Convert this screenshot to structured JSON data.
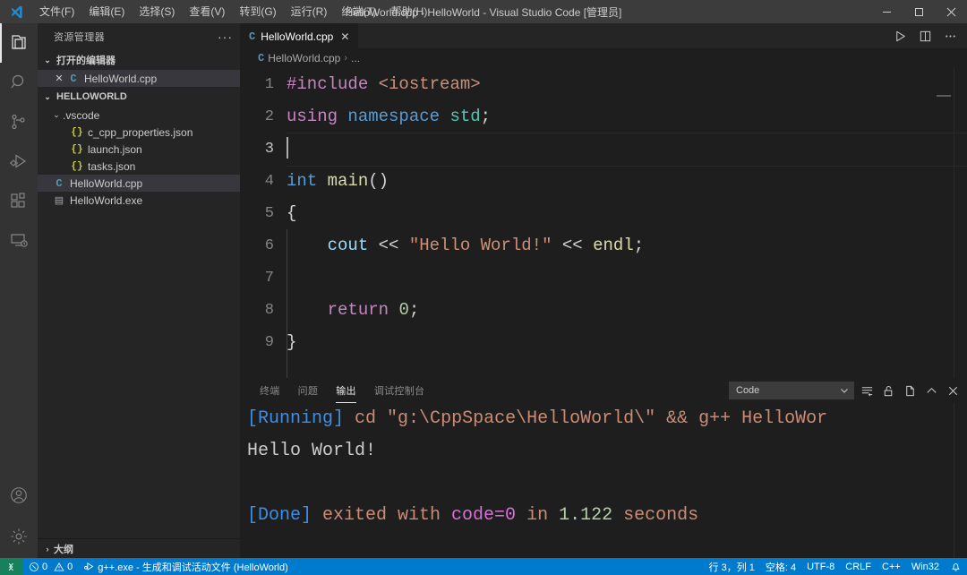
{
  "window": {
    "title": "HelloWorld.cpp - HelloWorld - Visual Studio Code [管理员]",
    "logo_icon": "vscode-logo-icon",
    "minimize_icon": "minimize-icon",
    "maximize_icon": "maximize-icon",
    "close_icon": "close-icon"
  },
  "menu": {
    "items": [
      {
        "label": "文件(F)"
      },
      {
        "label": "编辑(E)"
      },
      {
        "label": "选择(S)"
      },
      {
        "label": "查看(V)"
      },
      {
        "label": "转到(G)"
      },
      {
        "label": "运行(R)"
      },
      {
        "label": "终端(T)"
      },
      {
        "label": "帮助(H)"
      }
    ]
  },
  "activity_bar": {
    "items": [
      {
        "name": "explorer",
        "icon": "files-icon",
        "active": true
      },
      {
        "name": "search",
        "icon": "search-icon",
        "active": false
      },
      {
        "name": "source-control",
        "icon": "source-control-icon",
        "active": false
      },
      {
        "name": "run-and-debug",
        "icon": "run-debug-icon",
        "active": false
      },
      {
        "name": "extensions",
        "icon": "extensions-icon",
        "active": false
      },
      {
        "name": "remote-explorer",
        "icon": "remote-explorer-icon",
        "active": false
      }
    ],
    "bottom": [
      {
        "name": "accounts",
        "icon": "account-icon"
      },
      {
        "name": "manage",
        "icon": "gear-icon"
      }
    ]
  },
  "sidebar": {
    "title": "资源管理器",
    "more_actions": "···",
    "open_editors": {
      "label": "打开的编辑器",
      "expanded": true,
      "items": [
        {
          "label": "HelloWorld.cpp",
          "icon": "cpp-file-icon",
          "close": "✕",
          "selected": true
        }
      ]
    },
    "project": {
      "label": "HELLOWORLD",
      "expanded": true,
      "items": [
        {
          "label": ".vscode",
          "icon": "folder-icon",
          "indent": 1,
          "expanded": true,
          "selected": false
        },
        {
          "label": "c_cpp_properties.json",
          "icon": "json-file-icon",
          "indent": 2,
          "selected": false
        },
        {
          "label": "launch.json",
          "icon": "json-file-icon",
          "indent": 2,
          "selected": false
        },
        {
          "label": "tasks.json",
          "icon": "json-file-icon",
          "indent": 2,
          "selected": false
        },
        {
          "label": "HelloWorld.cpp",
          "icon": "cpp-file-icon",
          "indent": 1,
          "selected": true
        },
        {
          "label": "HelloWorld.exe",
          "icon": "exe-file-icon",
          "indent": 1,
          "selected": false
        }
      ]
    },
    "outline": {
      "label": "大纲",
      "expanded": false
    }
  },
  "editor": {
    "tab": {
      "label": "HelloWorld.cpp",
      "icon": "cpp-file-icon",
      "close": "✕",
      "active": true
    },
    "actions": [
      {
        "name": "run-code",
        "icon": "play-icon",
        "highlighted": true
      },
      {
        "name": "split-editor",
        "icon": "split-editor-icon",
        "highlighted": false
      },
      {
        "name": "more-actions",
        "icon": "ellipsis-icon",
        "highlighted": false
      }
    ],
    "highlight_color": "#ffff00",
    "breadcrumb": {
      "file": "HelloWorld.cpp",
      "separator": "›",
      "trail": "..."
    },
    "lines": [
      {
        "num": "1",
        "active": false,
        "tokens": [
          {
            "t": "#include",
            "c": "s-dir"
          },
          {
            "t": " ",
            "c": "s-pn"
          },
          {
            "t": "<iostream>",
            "c": "s-inc"
          }
        ]
      },
      {
        "num": "2",
        "active": false,
        "tokens": [
          {
            "t": "using",
            "c": "s-kw"
          },
          {
            "t": " ",
            "c": "s-pn"
          },
          {
            "t": "namespace",
            "c": "s-type"
          },
          {
            "t": " ",
            "c": "s-pn"
          },
          {
            "t": "std",
            "c": "s-ns"
          },
          {
            "t": ";",
            "c": "s-pn"
          }
        ]
      },
      {
        "num": "3",
        "active": true,
        "tokens": []
      },
      {
        "num": "4",
        "active": false,
        "tokens": [
          {
            "t": "int",
            "c": "s-type"
          },
          {
            "t": " ",
            "c": "s-pn"
          },
          {
            "t": "main",
            "c": "s-fn"
          },
          {
            "t": "()",
            "c": "s-pn"
          }
        ]
      },
      {
        "num": "5",
        "active": false,
        "tokens": [
          {
            "t": "{",
            "c": "s-pn"
          }
        ]
      },
      {
        "num": "6",
        "active": false,
        "tokens": [
          {
            "t": "    ",
            "c": "s-pn"
          },
          {
            "t": "cout",
            "c": "s-var"
          },
          {
            "t": " ",
            "c": "s-pn"
          },
          {
            "t": "<<",
            "c": "s-op"
          },
          {
            "t": " ",
            "c": "s-pn"
          },
          {
            "t": "\"Hello World!\"",
            "c": "s-str"
          },
          {
            "t": " ",
            "c": "s-pn"
          },
          {
            "t": "<<",
            "c": "s-op"
          },
          {
            "t": " ",
            "c": "s-pn"
          },
          {
            "t": "endl",
            "c": "s-fn"
          },
          {
            "t": ";",
            "c": "s-pn"
          }
        ]
      },
      {
        "num": "7",
        "active": false,
        "tokens": []
      },
      {
        "num": "8",
        "active": false,
        "tokens": [
          {
            "t": "    ",
            "c": "s-pn"
          },
          {
            "t": "return",
            "c": "s-kw"
          },
          {
            "t": " ",
            "c": "s-pn"
          },
          {
            "t": "0",
            "c": "s-num"
          },
          {
            "t": ";",
            "c": "s-pn"
          }
        ]
      },
      {
        "num": "9",
        "active": false,
        "tokens": [
          {
            "t": "}",
            "c": "s-pn"
          }
        ]
      }
    ]
  },
  "panel": {
    "tabs": [
      {
        "label": "终端",
        "active": false
      },
      {
        "label": "问题",
        "active": false
      },
      {
        "label": "输出",
        "active": true
      },
      {
        "label": "调试控制台",
        "active": false
      }
    ],
    "channel_select": {
      "value": "Code",
      "chevron": "chevron-down-icon"
    },
    "actions": [
      {
        "name": "clear-output",
        "icon": "clear-output-icon"
      },
      {
        "name": "lock-scroll",
        "icon": "unlock-icon"
      },
      {
        "name": "open-in-editor",
        "icon": "new-window-icon"
      },
      {
        "name": "maximize-panel",
        "icon": "chevron-up-icon"
      },
      {
        "name": "close-panel",
        "icon": "close-icon"
      }
    ],
    "output_lines": [
      {
        "tokens": [
          {
            "t": "[Running]",
            "c": "o-tag"
          },
          {
            "t": " ",
            "c": "o-cmd"
          },
          {
            "t": "cd \"g:\\CppSpace\\HelloWorld\\\" && g++ HelloWor",
            "c": "o-cmd"
          }
        ]
      },
      {
        "tokens": [
          {
            "t": "Hello World!",
            "c": "o-out"
          }
        ]
      },
      {
        "tokens": []
      },
      {
        "tokens": [
          {
            "t": "[Done]",
            "c": "o-tag"
          },
          {
            "t": " exited with ",
            "c": "o-cmd"
          },
          {
            "t": "code=0",
            "c": "o-code"
          },
          {
            "t": " in ",
            "c": "o-cmd"
          },
          {
            "t": "1.122",
            "c": "o-num"
          },
          {
            "t": " seconds",
            "c": "o-cmd"
          }
        ]
      }
    ]
  },
  "status_bar": {
    "remote_icon": "remote-host-icon",
    "errors": {
      "icon": "error-icon",
      "count": "0"
    },
    "warnings": {
      "icon": "warning-icon",
      "count": "0"
    },
    "task": {
      "icon": "debug-alt-icon",
      "label": "g++.exe - 生成和调试活动文件 (HelloWorld)"
    },
    "cursor_position": "行 3，列 1",
    "indentation": "空格: 4",
    "encoding": "UTF-8",
    "eol": "CRLF",
    "language": "C++",
    "platform": "Win32",
    "bell_icon": "bell-icon"
  }
}
